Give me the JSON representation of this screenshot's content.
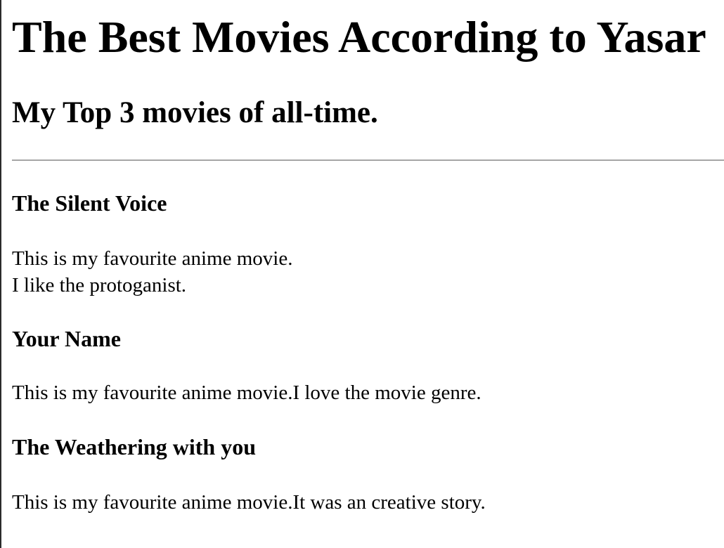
{
  "page": {
    "title": "The Best Movies According to Yasar",
    "subtitle": "My Top 3 movies of all-time."
  },
  "movies": [
    {
      "title": "The Silent Voice",
      "description_line1": "This is my favourite anime movie.",
      "description_line2": "I like the protoganist."
    },
    {
      "title": "Your Name",
      "description": "This is my favourite anime movie.I love the movie genre."
    },
    {
      "title": "The Weathering with you",
      "description": "This is my favourite anime movie.It was an creative story."
    }
  ]
}
